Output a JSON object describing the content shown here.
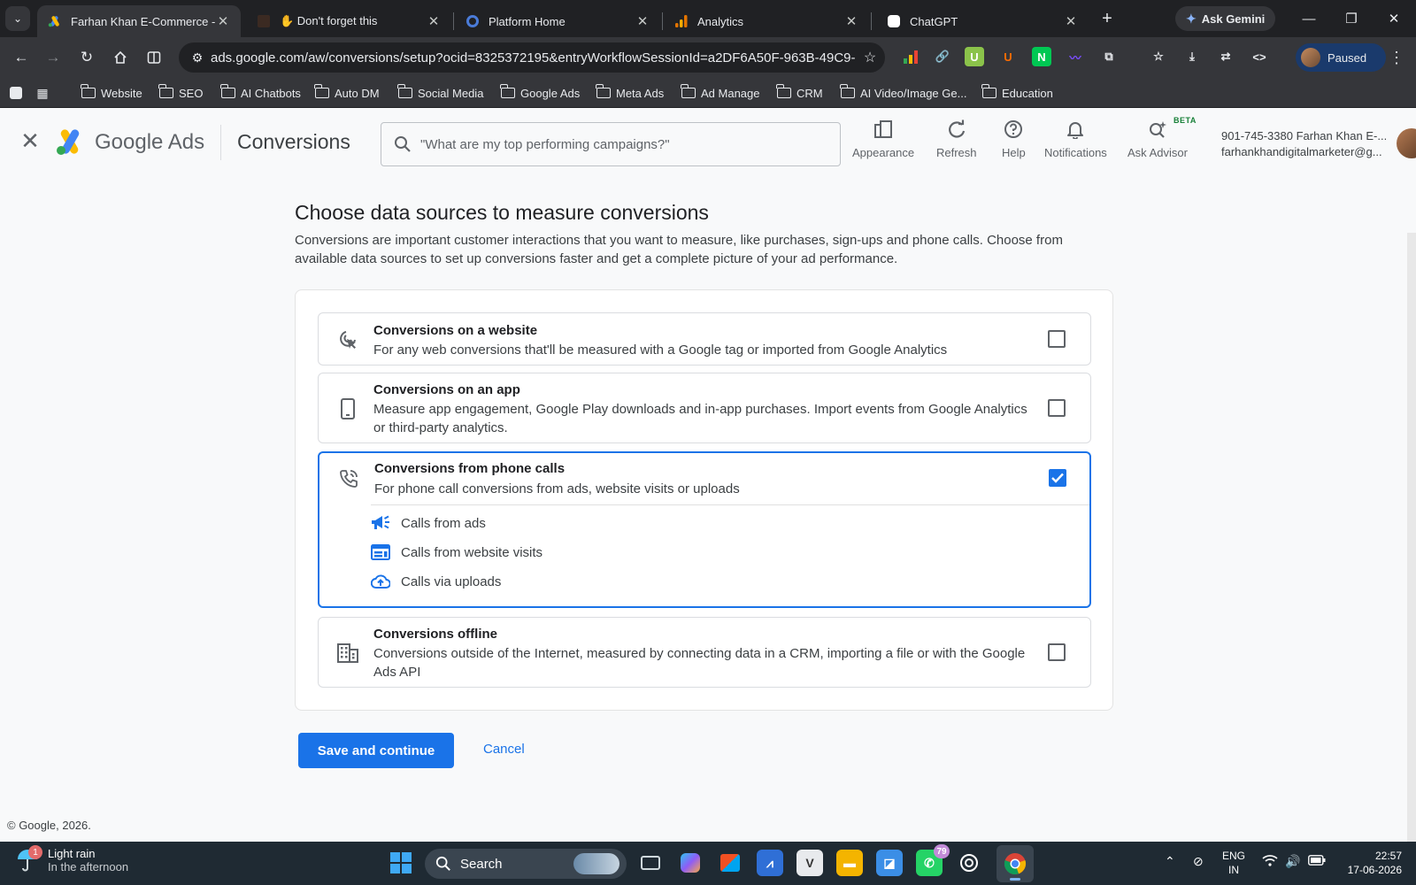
{
  "browser": {
    "tabs": [
      {
        "title": "Farhan Khan E-Commerce - G",
        "active": true,
        "icon": "google-ads-icon"
      },
      {
        "title": "✋ Don't forget this",
        "active": false,
        "icon": "image-thumbnail-icon"
      },
      {
        "title": "Platform Home",
        "active": false,
        "icon": "platform-logo-icon"
      },
      {
        "title": "Analytics",
        "active": false,
        "icon": "analytics-icon"
      },
      {
        "title": "ChatGPT",
        "active": false,
        "icon": "chatgpt-icon"
      }
    ],
    "gemini_label": "Ask Gemini",
    "url": "ads.google.com/aw/conversions/setup?ocid=8325372195&entryWorkflowSessionId=a2DF6A50F-963B-49C9-...",
    "profile_label": "Paused",
    "bookmarks": [
      "Website",
      "SEO",
      "AI Chatbots",
      "Auto DM",
      "Social Media",
      "Google Ads",
      "Meta Ads",
      "Ad Manage",
      "CRM",
      "AI Video/Image Ge...",
      "Education"
    ]
  },
  "header": {
    "brand": "Google Ads",
    "page_title": "Conversions",
    "search_placeholder": "\"What are my top performing campaigns?\"",
    "actions": [
      {
        "label": "Appearance",
        "icon": "appearance-icon"
      },
      {
        "label": "Refresh",
        "icon": "refresh-icon"
      },
      {
        "label": "Help",
        "icon": "help-icon"
      },
      {
        "label": "Notifications",
        "icon": "bell-icon"
      },
      {
        "label": "Ask Advisor",
        "icon": "advisor-icon"
      }
    ],
    "beta_label": "BETA",
    "account_line1": "901-745-3380 Farhan Khan E-...",
    "account_line2": "farhankhandigitalmarketer@g..."
  },
  "main": {
    "title": "Choose data sources to measure conversions",
    "description": "Conversions are important customer interactions that you want to measure, like purchases, sign-ups and phone calls. Choose from available data sources to set up conversions faster and get a complete picture of your ad performance.",
    "options": [
      {
        "title": "Conversions on a website",
        "desc": "For any web conversions that'll be measured with a Google tag or imported from Google Analytics",
        "checked": false,
        "icon": "website-cursor-icon"
      },
      {
        "title": "Conversions on an app",
        "desc": "Measure app engagement, Google Play downloads and in-app purchases. Import events from Google Analytics or third-party analytics.",
        "checked": false,
        "icon": "phone-device-icon"
      },
      {
        "title": "Conversions from phone calls",
        "desc": "For phone call conversions from ads, website visits or uploads",
        "checked": true,
        "icon": "phone-call-icon",
        "subitems": [
          {
            "label": "Calls from ads",
            "icon": "megaphone-icon"
          },
          {
            "label": "Calls from website visits",
            "icon": "web-page-icon"
          },
          {
            "label": "Calls via uploads",
            "icon": "cloud-upload-icon"
          }
        ]
      },
      {
        "title": "Conversions offline",
        "desc": "Conversions outside of the Internet, measured by connecting data in a CRM, importing a file or with the Google Ads API",
        "checked": false,
        "icon": "building-icon"
      }
    ],
    "save_label": "Save and continue",
    "cancel_label": "Cancel",
    "copyright": "© Google, 2026."
  },
  "taskbar": {
    "weather_title": "Light rain",
    "weather_sub": "In the afternoon",
    "weather_badge": "1",
    "search_label": "Search",
    "whatsapp_badge": "79",
    "lang_line1": "ENG",
    "lang_line2": "IN",
    "time": "22:57",
    "date": "17-06-2026"
  },
  "colors": {
    "accent": "#1a73e8",
    "chrome_dark": "#202124",
    "chrome_mid": "#35363a",
    "taskbar": "#1f2a33"
  }
}
